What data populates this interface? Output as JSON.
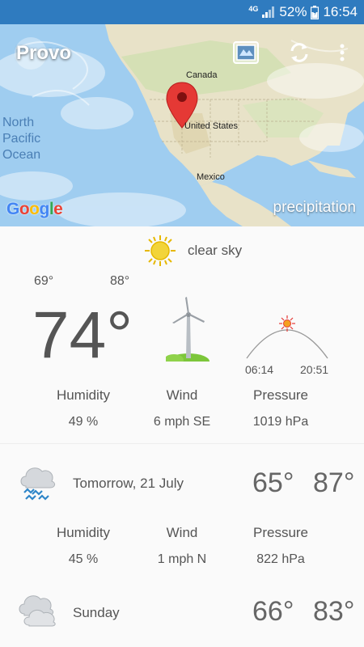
{
  "status_bar": {
    "network": "4G",
    "battery": "52%",
    "time": "16:54"
  },
  "map": {
    "city": "Provo",
    "labels": {
      "canada": "Canada",
      "us": "United States",
      "mexico": "Mexico",
      "ocean_line1": "North",
      "ocean_line2": "Pacific",
      "ocean_line3": "Ocean"
    },
    "brand": "Google",
    "layer": "precipitation"
  },
  "today": {
    "description": "clear sky",
    "min": "69°",
    "max": "88°",
    "temp": "74°",
    "sunrise": "06:14",
    "sunset": "20:51",
    "humidity_label": "Humidity",
    "wind_label": "Wind",
    "pressure_label": "Pressure",
    "humidity": "49 %",
    "wind": "6 mph SE",
    "pressure": "1019 hPa"
  },
  "forecast": [
    {
      "date": "Tomorrow, 21 July",
      "low": "65°",
      "high": "87°",
      "icon": "rain-cloud-icon",
      "humidity_label": "Humidity",
      "wind_label": "Wind",
      "pressure_label": "Pressure",
      "humidity": "45 %",
      "wind": "1 mph N",
      "pressure": "822 hPa"
    },
    {
      "date": "Sunday",
      "low": "66°",
      "high": "83°",
      "icon": "cloud-icon"
    }
  ],
  "colors": {
    "status_bar": "#2f7bbf",
    "sun": "#f2d43a",
    "rain": "#2f86c8",
    "grass": "#7cc63a"
  }
}
